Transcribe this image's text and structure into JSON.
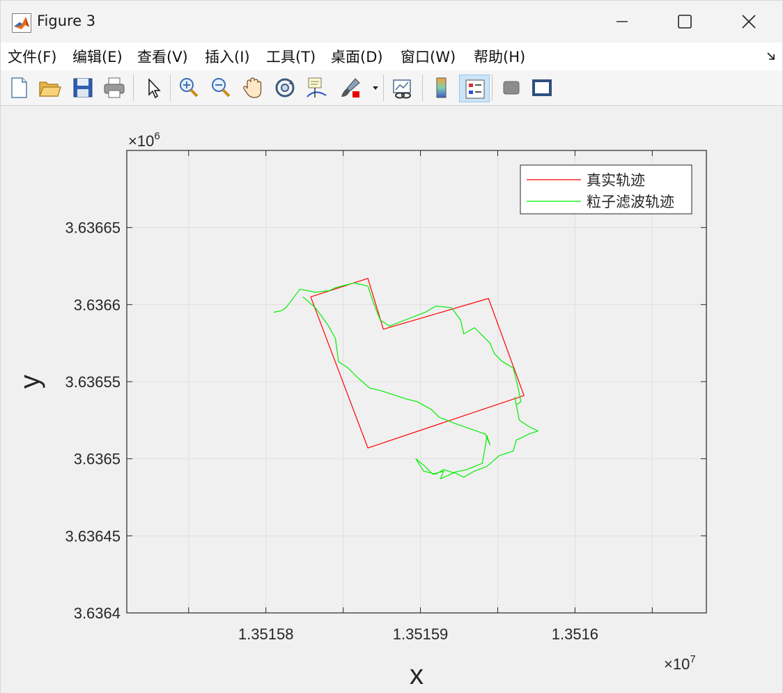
{
  "window": {
    "title": "Figure 3",
    "icon": "matlab-icon"
  },
  "menu": {
    "items": [
      {
        "label": "文件(F)"
      },
      {
        "label": "编辑(E)"
      },
      {
        "label": "查看(V)"
      },
      {
        "label": "插入(I)"
      },
      {
        "label": "工具(T)"
      },
      {
        "label": "桌面(D)"
      },
      {
        "label": "窗口(W)"
      },
      {
        "label": "帮助(H)"
      }
    ]
  },
  "toolbar": {
    "buttons": [
      "new-figure-icon",
      "open-file-icon",
      "save-icon",
      "print-icon",
      "pointer-icon",
      "zoom-in-icon",
      "zoom-out-icon",
      "pan-hand-icon",
      "rotate-3d-icon",
      "data-cursor-icon",
      "brush-icon",
      "link-plot-icon",
      "colorbar-icon",
      "legend-icon",
      "hide-plot-tools-icon",
      "show-plot-tools-icon"
    ],
    "active": "legend-icon"
  },
  "chart_data": {
    "type": "line",
    "xlabel": "x",
    "ylabel": "y",
    "x_exponent_label": "×10",
    "x_exponent": "7",
    "y_exponent_label": "×10",
    "y_exponent": "6",
    "xlim": [
      13515710,
      13516085
    ],
    "ylim": [
      3636400,
      3636700
    ],
    "xticks": [
      13515750,
      13515800,
      13515850,
      13515900,
      13515950,
      13516000,
      13516050
    ],
    "xtick_labels": [
      "",
      "1.35158",
      "",
      "1.35159",
      "",
      "1.3516",
      ""
    ],
    "yticks": [
      3636400,
      3636450,
      3636500,
      3636550,
      3636600,
      3636650
    ],
    "ytick_labels": [
      "3.6364",
      "3.63645",
      "3.6365",
      "3.63655",
      "3.6366",
      "3.63665"
    ],
    "grid": true,
    "legend_placement": "top-right",
    "series": [
      {
        "name": "真实轨迹",
        "color": "#ff0000",
        "points": [
          [
            13515829,
            3636605
          ],
          [
            13515866,
            3636617
          ],
          [
            13515876,
            3636584
          ],
          [
            13515944,
            3636604
          ],
          [
            13515967,
            3636541
          ],
          [
            13515866,
            3636507
          ],
          [
            13515829,
            3636605
          ]
        ]
      },
      {
        "name": "粒子滤波轨迹",
        "color": "#00ee00",
        "points": [
          [
            13515805,
            3636595
          ],
          [
            13515810,
            3636596
          ],
          [
            13515813,
            3636598
          ],
          [
            13515822,
            3636610
          ],
          [
            13515832,
            3636608
          ],
          [
            13515841,
            3636609
          ],
          [
            13515845,
            3636611
          ],
          [
            13515857,
            3636614
          ],
          [
            13515862,
            3636613
          ],
          [
            13515866,
            3636612
          ],
          [
            13515870,
            3636600
          ],
          [
            13515874,
            3636590
          ],
          [
            13515880,
            3636586
          ],
          [
            13515890,
            3636590
          ],
          [
            13515903,
            3636595
          ],
          [
            13515910,
            3636599
          ],
          [
            13515920,
            3636598
          ],
          [
            13515926,
            3636590
          ],
          [
            13515928,
            3636581
          ],
          [
            13515935,
            3636585
          ],
          [
            13515945,
            3636575
          ],
          [
            13515948,
            3636568
          ],
          [
            13515953,
            3636563
          ],
          [
            13515960,
            3636559
          ],
          [
            13515963,
            3636547
          ],
          [
            13515965,
            3636537
          ],
          [
            13515962,
            3636535
          ],
          [
            13515961,
            3636540
          ],
          [
            13515964,
            3636525
          ],
          [
            13515970,
            3636521
          ],
          [
            13515976,
            3636518
          ],
          [
            13515970,
            3636516
          ],
          [
            13515962,
            3636512
          ],
          [
            13515960,
            3636505
          ],
          [
            13515951,
            3636502
          ],
          [
            13515943,
            3636495
          ],
          [
            13515935,
            3636492
          ],
          [
            13515928,
            3636488
          ],
          [
            13515922,
            3636491
          ],
          [
            13515913,
            3636487
          ],
          [
            13515915,
            3636492
          ],
          [
            13515908,
            3636490
          ],
          [
            13515903,
            3636495
          ],
          [
            13515897,
            3636500
          ],
          [
            13515902,
            3636492
          ],
          [
            13515910,
            3636490
          ],
          [
            13515915,
            3636493
          ],
          [
            13515921,
            3636491
          ],
          [
            13515930,
            3636493
          ],
          [
            13515935,
            3636495
          ],
          [
            13515940,
            3636497
          ],
          [
            13515942,
            3636508
          ],
          [
            13515943,
            3636515
          ],
          [
            13515945,
            3636509
          ],
          [
            13515942,
            3636516
          ],
          [
            13515922,
            3636523
          ],
          [
            13515912,
            3636527
          ],
          [
            13515907,
            3636532
          ],
          [
            13515898,
            3636537
          ],
          [
            13515890,
            3636539
          ],
          [
            13515875,
            3636544
          ],
          [
            13515867,
            3636546
          ],
          [
            13515859,
            3636553
          ],
          [
            13515853,
            3636559
          ],
          [
            13515847,
            3636563
          ],
          [
            13515845,
            3636578
          ],
          [
            13515840,
            3636587
          ],
          [
            13515832,
            3636598
          ],
          [
            13515824,
            3636605
          ]
        ]
      }
    ]
  }
}
